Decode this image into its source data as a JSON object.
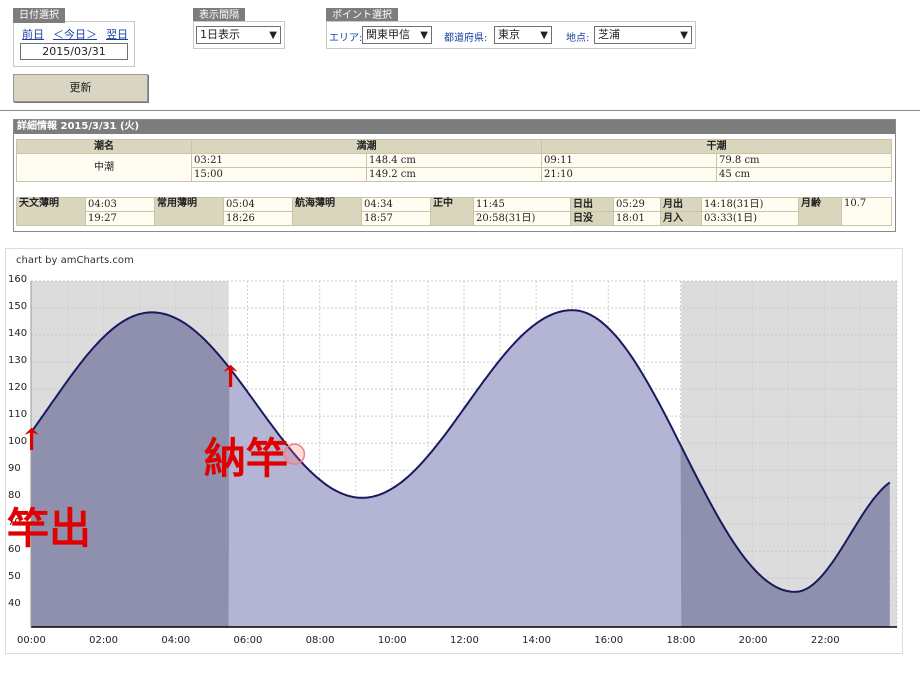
{
  "date_select": {
    "label": "日付選択",
    "prev": "前日",
    "today": "＜今日＞",
    "next": "翌日",
    "date": "2015/03/31"
  },
  "interval_select": {
    "label": "表示間隔",
    "value": "1日表示"
  },
  "point_select": {
    "label": "ポイント選択",
    "area_label": "エリア:",
    "area_value": "関東甲信",
    "pref_label": "都道府県:",
    "pref_value": "東京",
    "spot_label": "地点:",
    "spot_value": "芝浦"
  },
  "update_button": "更新",
  "detail": {
    "title": "詳細情報 2015/3/31 (火)",
    "tide_name_header": "潮名",
    "high_header": "満潮",
    "low_header": "干潮",
    "tide_name": "中潮",
    "high_times": [
      "03:21",
      "15:00"
    ],
    "high_levels": [
      "148.4 cm",
      "149.2 cm"
    ],
    "low_times": [
      "09:11",
      "21:10"
    ],
    "low_levels": [
      "79.8 cm",
      "45 cm"
    ],
    "astro_label": "天文薄明",
    "astro": [
      "04:03",
      "19:27"
    ],
    "civil_label": "常用薄明",
    "civil": [
      "05:04",
      "18:26"
    ],
    "nautical_label": "航海薄明",
    "nautical": [
      "04:34",
      "18:57"
    ],
    "noon_label": "正中",
    "noon": [
      "11:45",
      "20:58(31日)"
    ],
    "sunrise_label": "日出",
    "sunrise": "05:29",
    "sunset_label": "日没",
    "sunset": "18:01",
    "moonrise_label": "月出",
    "moonrise": "14:18(31日)",
    "moonset_label": "月入",
    "moonset": "03:33(1日)",
    "moon_age_label": "月齢",
    "moon_age": "10.7"
  },
  "chart_credit": "chart by amCharts.com",
  "annotations": {
    "start_label": "竿出",
    "end_label": "納竿",
    "arrow": "↑"
  },
  "colors": {
    "line": "#1a1a60",
    "fill_day": "#b4b4d4",
    "fill_night": "#8f8fae",
    "night_bg": "#dcdcdc",
    "annot": "#e00000"
  },
  "chart_data": {
    "type": "area",
    "x_ticks": [
      "00:00",
      "02:00",
      "04:00",
      "06:00",
      "08:00",
      "10:00",
      "12:00",
      "14:00",
      "16:00",
      "18:00",
      "20:00",
      "22:00"
    ],
    "y_ticks": [
      40,
      50,
      60,
      70,
      80,
      90,
      100,
      110,
      120,
      130,
      140,
      150,
      160
    ],
    "ylim": [
      32,
      160
    ],
    "xlim_hours": [
      0,
      24
    ],
    "night_bands_hours": [
      [
        0,
        5.48
      ],
      [
        18.02,
        24
      ]
    ],
    "extremes": [
      {
        "time_h": 3.35,
        "value": 148.4
      },
      {
        "time_h": 9.18,
        "value": 79.8
      },
      {
        "time_h": 15.0,
        "value": 149.2
      },
      {
        "time_h": 21.17,
        "value": 45
      }
    ],
    "start_value": 104,
    "end_value": 87
  }
}
